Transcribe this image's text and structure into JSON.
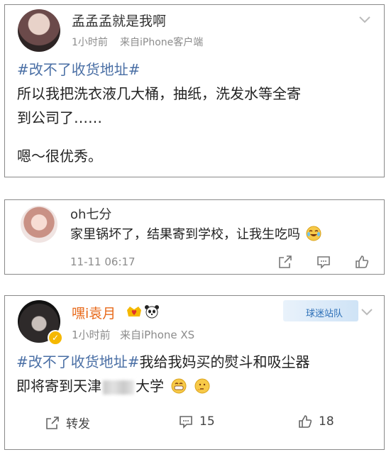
{
  "post1": {
    "username": "孟孟孟就是我啊",
    "time": "1小时前",
    "source": "来自iPhone客户端",
    "hashtag": "#改不了收货地址#",
    "line1": "所以我把洗衣液几大桶，抽纸，洗发水等全寄",
    "line2": "到公司了……",
    "line3": "嗯～很优秀。"
  },
  "comment": {
    "username": "oh七分",
    "text": "家里锅坏了，结果寄到学校，让我生吃吗",
    "time": "11-11 06:17"
  },
  "post2": {
    "username": "嘿i袁月",
    "time": "1小时前",
    "source": "来自iPhone XS",
    "hashtag": "#改不了收货地址#",
    "line1_rest": "我给我妈买的熨斗和吸尘器",
    "line2_start": "即将寄到天津",
    "line2_end": "大学",
    "watermark": "球迷站队",
    "repost_label": "转发",
    "comment_count": "15",
    "like_count": "18"
  },
  "colors": {
    "link": "#4a6fa5",
    "meta": "#8c8c8c",
    "border": "#8a8a8a"
  }
}
